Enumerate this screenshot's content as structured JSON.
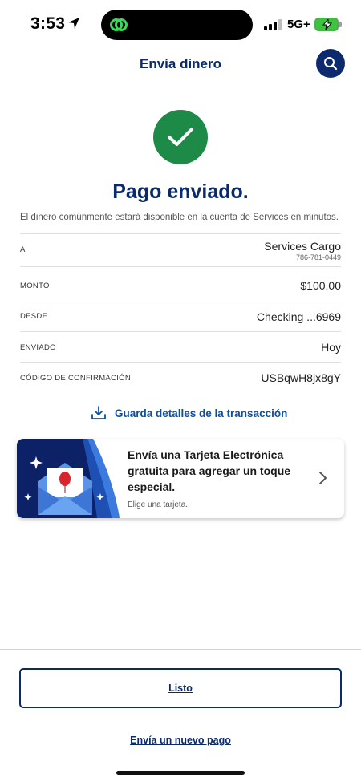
{
  "status_bar": {
    "time": "3:53",
    "network": "5G+"
  },
  "header": {
    "title": "Envía dinero",
    "search_icon": "search-icon"
  },
  "success": {
    "icon": "check-icon",
    "title": "Pago enviado.",
    "info": "El dinero comúnmente estará disponible en la cuenta de Services en minutos."
  },
  "details": {
    "to": {
      "label": "A",
      "value": "Services Cargo",
      "sub": "786-781-0449"
    },
    "amount": {
      "label": "MONTO",
      "value": "$100.00"
    },
    "from": {
      "label": "DESDE",
      "value": "Checking ...6969"
    },
    "sent": {
      "label": "ENVIADO",
      "value": "Hoy"
    },
    "confirmation": {
      "label": "CÓDIGO DE CONFIRMACIÓN",
      "value": "USBqwH8jx8gY"
    }
  },
  "save_link": {
    "label": "Guarda detalles de la transacción",
    "icon": "download-icon"
  },
  "ecard": {
    "title": "Envía una Tarjeta Electrónica gratuita para agregar un toque especial.",
    "subtitle": "Elige una tarjeta.",
    "icon": "chevron-right-icon"
  },
  "actions": {
    "done": "Listo",
    "new_payment": "Envía un nuevo pago"
  },
  "colors": {
    "brand_navy": "#0b2a6b",
    "success_green": "#1e8a48",
    "link_blue": "#0b4fa3"
  }
}
